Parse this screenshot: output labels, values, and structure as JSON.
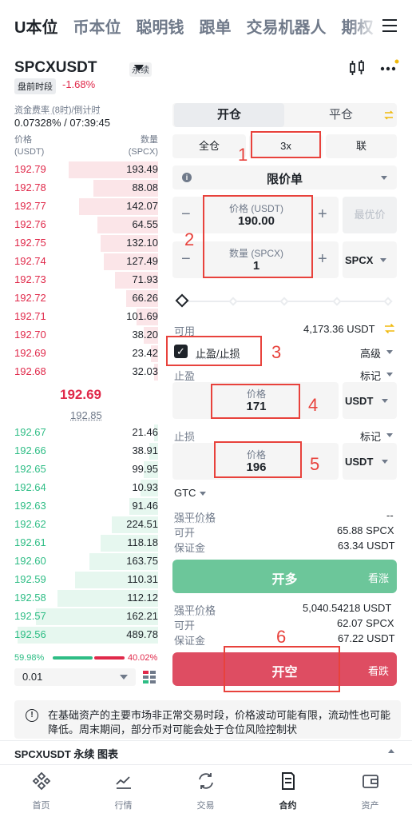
{
  "top_tabs": [
    "U本位",
    "币本位",
    "聪明钱",
    "跟单",
    "交易机器人",
    "期权"
  ],
  "symbol": {
    "name": "SPCXUSDT",
    "tag": "永续",
    "session": "盘前时段",
    "change": "-1.68%"
  },
  "funding": {
    "label": "资金费率 (8时)/倒计时",
    "value": "0.07328% / 07:39:45"
  },
  "orderbook": {
    "head_price": "价格",
    "head_price_unit": "(USDT)",
    "head_qty": "数量",
    "head_qty_unit": "(SPCX)",
    "asks": [
      {
        "price": "192.79",
        "qty": "193.49",
        "depth": 0.62
      },
      {
        "price": "192.78",
        "qty": "88.08",
        "depth": 0.45
      },
      {
        "price": "192.77",
        "qty": "142.07",
        "depth": 0.55
      },
      {
        "price": "192.76",
        "qty": "64.55",
        "depth": 0.42
      },
      {
        "price": "192.75",
        "qty": "132.10",
        "depth": 0.4
      },
      {
        "price": "192.74",
        "qty": "127.49",
        "depth": 0.38
      },
      {
        "price": "192.73",
        "qty": "71.93",
        "depth": 0.3
      },
      {
        "price": "192.72",
        "qty": "66.26",
        "depth": 0.22
      },
      {
        "price": "192.71",
        "qty": "101.69",
        "depth": 0.15
      },
      {
        "price": "192.70",
        "qty": "38.20",
        "depth": 0.1
      },
      {
        "price": "192.69",
        "qty": "23.42",
        "depth": 0.05
      },
      {
        "price": "192.68",
        "qty": "32.03",
        "depth": 0.03
      }
    ],
    "mid_price": "192.69",
    "mark_price": "192.85",
    "bids": [
      {
        "price": "192.67",
        "qty": "21.46",
        "depth": 0.03
      },
      {
        "price": "192.66",
        "qty": "38.91",
        "depth": 0.06
      },
      {
        "price": "192.65",
        "qty": "99.95",
        "depth": 0.1
      },
      {
        "price": "192.64",
        "qty": "10.93",
        "depth": 0.12
      },
      {
        "price": "192.63",
        "qty": "91.46",
        "depth": 0.2
      },
      {
        "price": "192.62",
        "qty": "224.51",
        "depth": 0.32
      },
      {
        "price": "192.61",
        "qty": "118.18",
        "depth": 0.4
      },
      {
        "price": "192.60",
        "qty": "163.75",
        "depth": 0.48
      },
      {
        "price": "192.59",
        "qty": "110.31",
        "depth": 0.58
      },
      {
        "price": "192.58",
        "qty": "112.12",
        "depth": 0.7
      },
      {
        "price": "192.57",
        "qty": "162.21",
        "depth": 0.85
      },
      {
        "price": "192.56",
        "qty": "489.78",
        "depth": 0.98
      }
    ],
    "buy_ratio": "59.98%",
    "sell_ratio": "40.02%",
    "depth_step": "0.01"
  },
  "order_form": {
    "tab_open": "开仓",
    "tab_close": "平仓",
    "margin_mode": "全仓",
    "leverage": "3x",
    "mode_right": "联",
    "order_type": "限价单",
    "price_label": "价格 (USDT)",
    "price_value": "190.00",
    "bbo_label": "最优价",
    "qty_label": "数量 (SPCX)",
    "qty_value": "1",
    "qty_unit": "SPCX",
    "available_label": "可用",
    "available_value": "4,173.36 USDT",
    "tpsl_label": "止盈/止损",
    "advanced_label": "高级",
    "tp_label": "止盈",
    "sl_label": "止损",
    "mark_label": "标记",
    "tp_price_label": "价格",
    "tp_price_value": "171",
    "tp_unit": "USDT",
    "sl_price_label": "价格",
    "sl_price_value": "196",
    "sl_unit": "USDT",
    "tif": "GTC",
    "long": {
      "liq_label": "强平价格",
      "liq_value": "--",
      "open_label": "可开",
      "open_value": "65.88 SPCX",
      "margin_label": "保证金",
      "margin_value": "63.34 USDT",
      "button": "开多",
      "button_side": "看涨"
    },
    "short": {
      "liq_label": "强平价格",
      "liq_value": "5,040.54218 USDT",
      "open_label": "可开",
      "open_value": "62.07 SPCX",
      "margin_label": "保证金",
      "margin_value": "67.22 USDT",
      "button": "开空",
      "button_side": "看跌"
    }
  },
  "annotations": [
    "1",
    "2",
    "3",
    "4",
    "5",
    "6"
  ],
  "notice": "在基础资产的主要市场非正常交易时段，价格波动可能有限，流动性也可能降低。周末期间，部分币对可能会处于仓位风险控制状",
  "chart_bar": "SPCXUSDT 永续 图表",
  "bottom_nav": [
    {
      "label": "首页",
      "icon": "home-icon"
    },
    {
      "label": "行情",
      "icon": "markets-icon"
    },
    {
      "label": "交易",
      "icon": "trade-icon"
    },
    {
      "label": "合约",
      "icon": "futures-icon"
    },
    {
      "label": "资产",
      "icon": "wallet-icon"
    }
  ],
  "colors": {
    "up": "#2ebd85",
    "down": "#e0294a",
    "annotation": "#e8423c"
  }
}
